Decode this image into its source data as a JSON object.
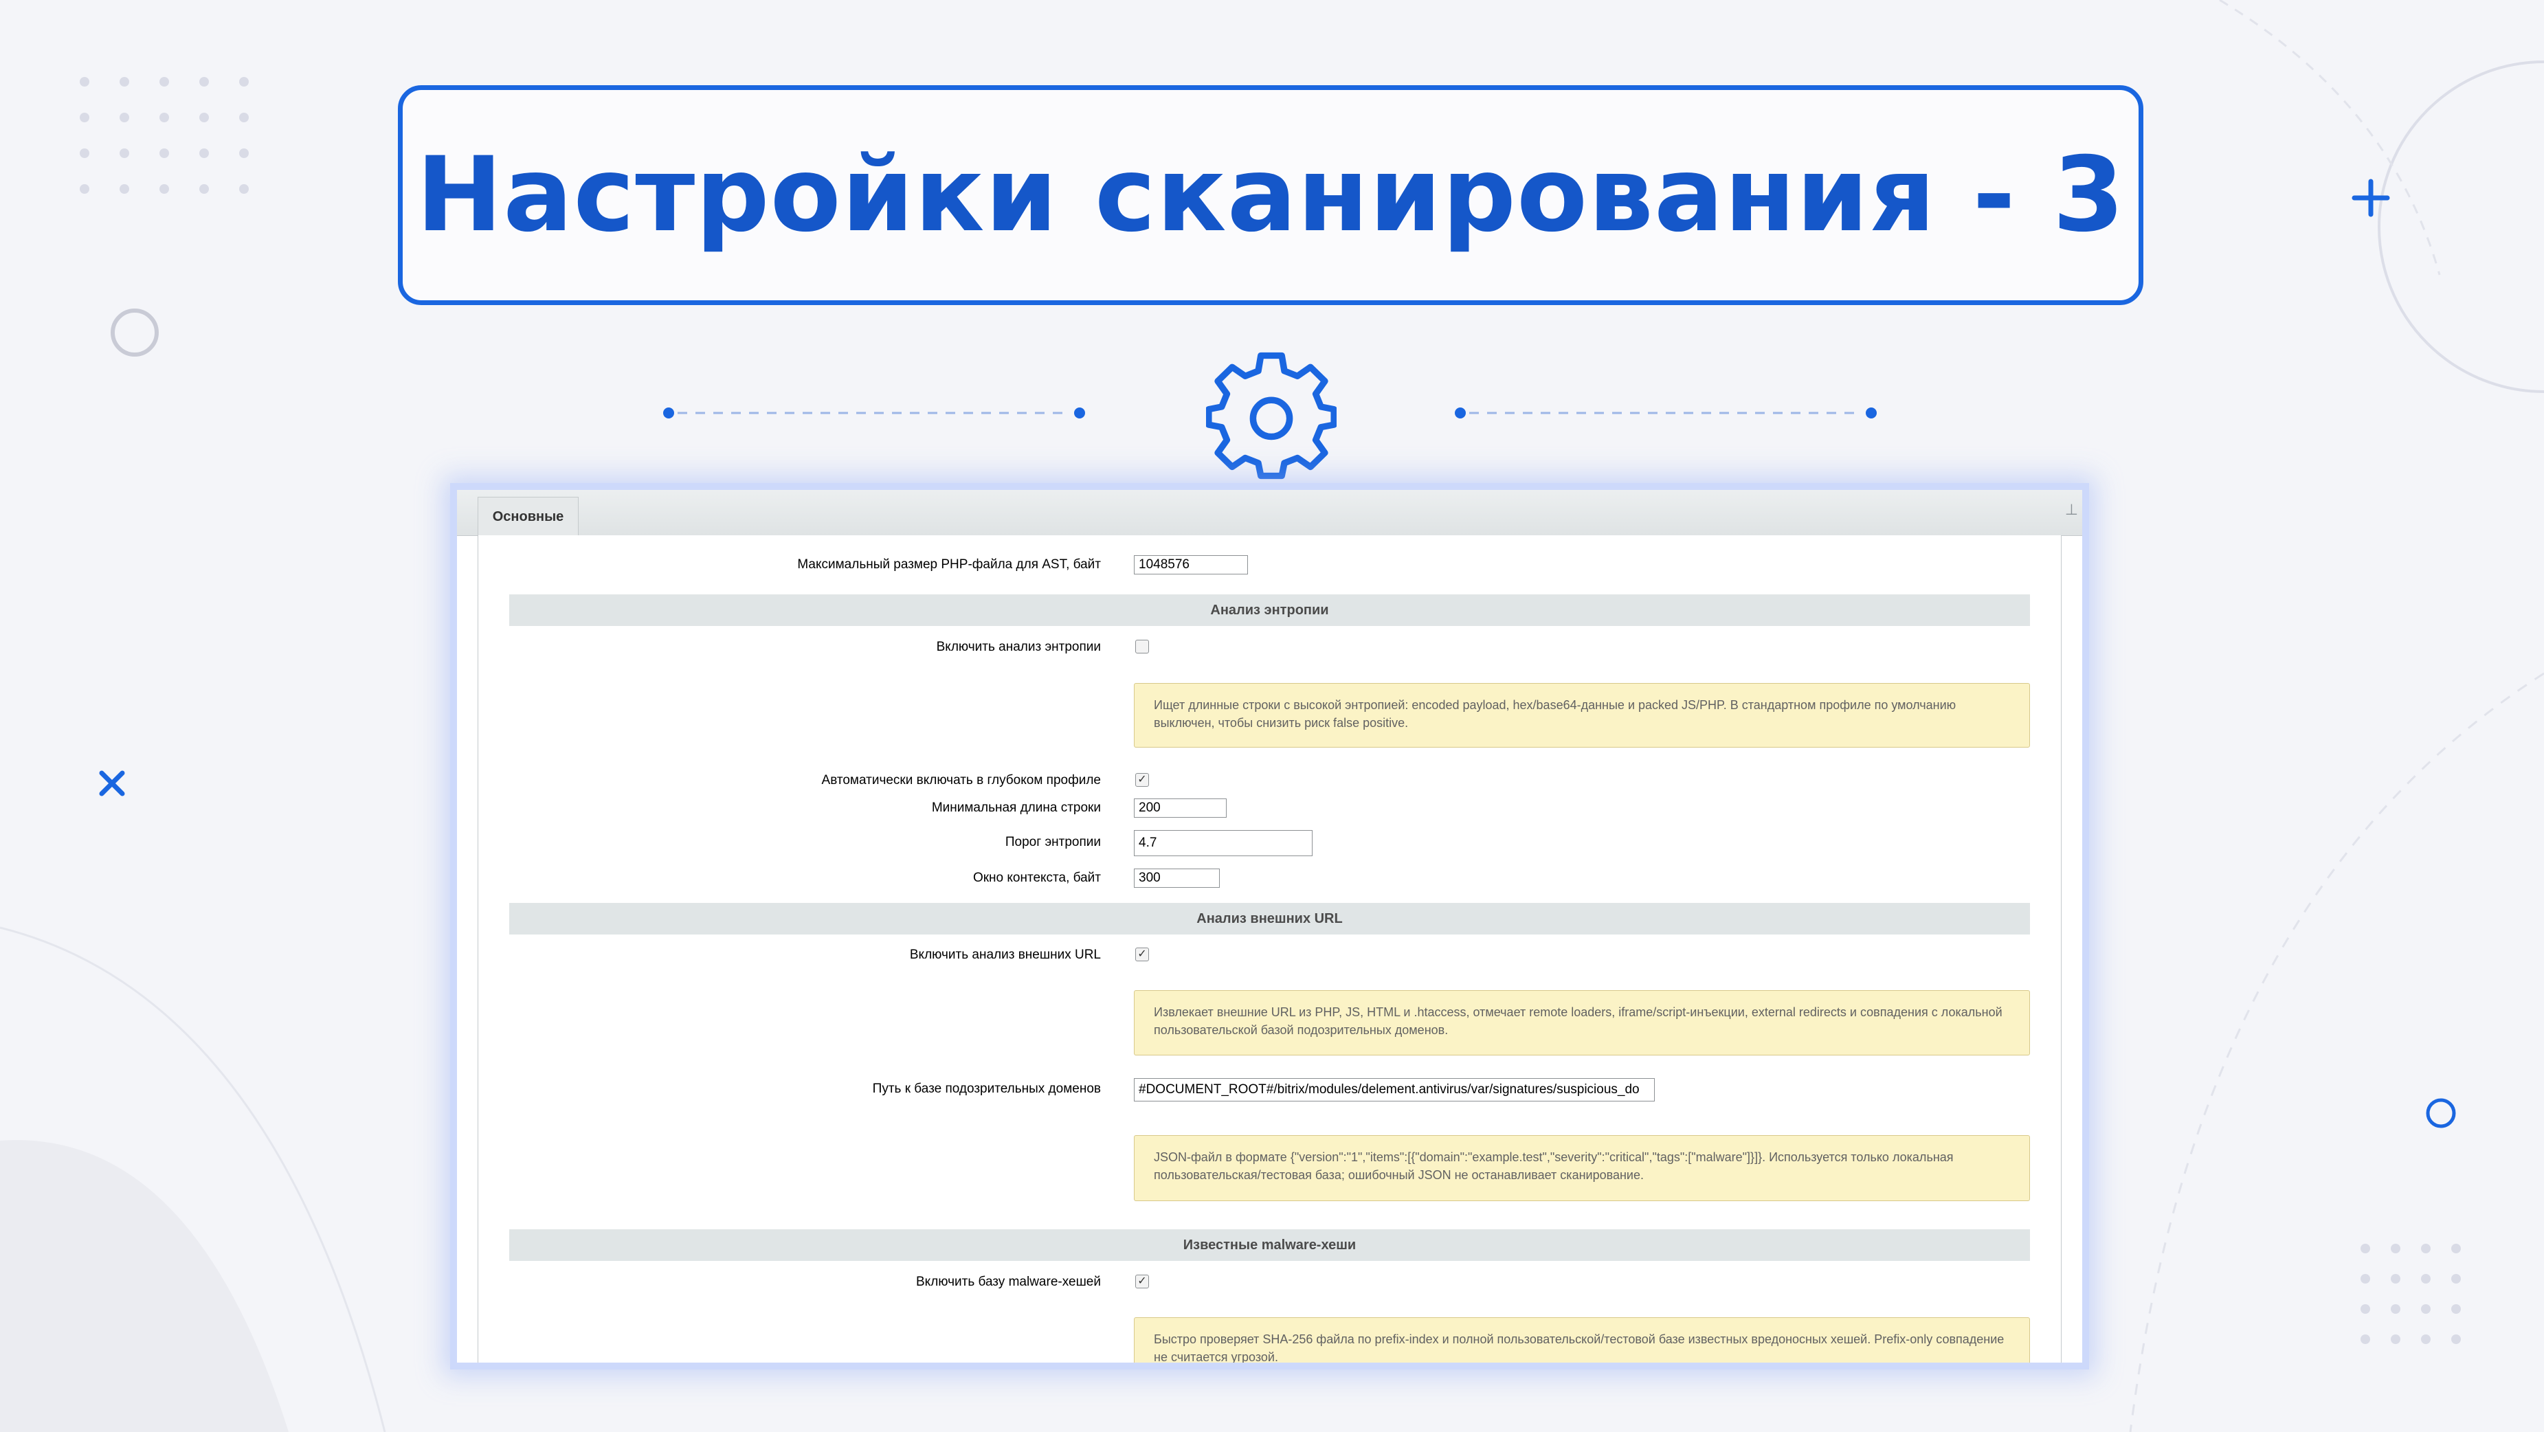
{
  "title": "Настройки сканирования - 3",
  "tab": {
    "label": "Основные"
  },
  "fields": {
    "ast_max_size": {
      "label": "Максимальный размер PHP-файла для AST, байт",
      "value": "1048576"
    },
    "entropy_enable": {
      "label": "Включить анализ энтропии",
      "checked": false
    },
    "entropy_note": "Ищет длинные строки с высокой энтропией: encoded payload, hex/base64-данные и packed JS/PHP. В стандартном профиле по умолчанию выключен, чтобы снизить риск false positive.",
    "entropy_auto": {
      "label": "Автоматически включать в глубоком профиле",
      "checked": true
    },
    "min_length": {
      "label": "Минимальная длина строки",
      "value": "200"
    },
    "entropy_threshold": {
      "label": "Порог энтропии",
      "value": "4.7"
    },
    "context_window": {
      "label": "Окно контекста, байт",
      "value": "300"
    },
    "url_enable": {
      "label": "Включить анализ внешних URL",
      "checked": true
    },
    "url_note": "Извлекает внешние URL из PHP, JS, HTML и .htaccess, отмечает remote loaders, iframe/script-инъекции, external redirects и совпадения с локальной пользовательской базой подозрительных доменов.",
    "domains_path": {
      "label": "Путь к базе подозрительных доменов",
      "value": "#DOCUMENT_ROOT#/bitrix/modules/delement.antivirus/var/signatures/suspicious_do"
    },
    "domains_note": "JSON-файл в формате {\"version\":\"1\",\"items\":[{\"domain\":\"example.test\",\"severity\":\"critical\",\"tags\":[\"malware\"]}]}. Используется только локальная пользовательская/тестовая база; ошибочный JSON не останавливает сканирование.",
    "hash_enable": {
      "label": "Включить базу malware-хешей",
      "checked": true
    },
    "hash_note": "Быстро проверяет SHA-256 файла по prefix-index и полной пользовательской/тестовой базе известных вредоносных хешей. Prefix-only совпадение не считается угрозой."
  },
  "sections": {
    "entropy": "Анализ энтропии",
    "urls": "Анализ внешних URL",
    "hashes": "Известные malware-хеши"
  },
  "icons": {
    "gear": "gear-icon",
    "pin": "pin-icon",
    "plus": "plus-icon",
    "cross": "cross-icon"
  },
  "colors": {
    "accent": "#1a66e0",
    "title_text": "#1557c9",
    "note_bg": "#fbf3c6",
    "section_bg": "#e0e5e6"
  }
}
